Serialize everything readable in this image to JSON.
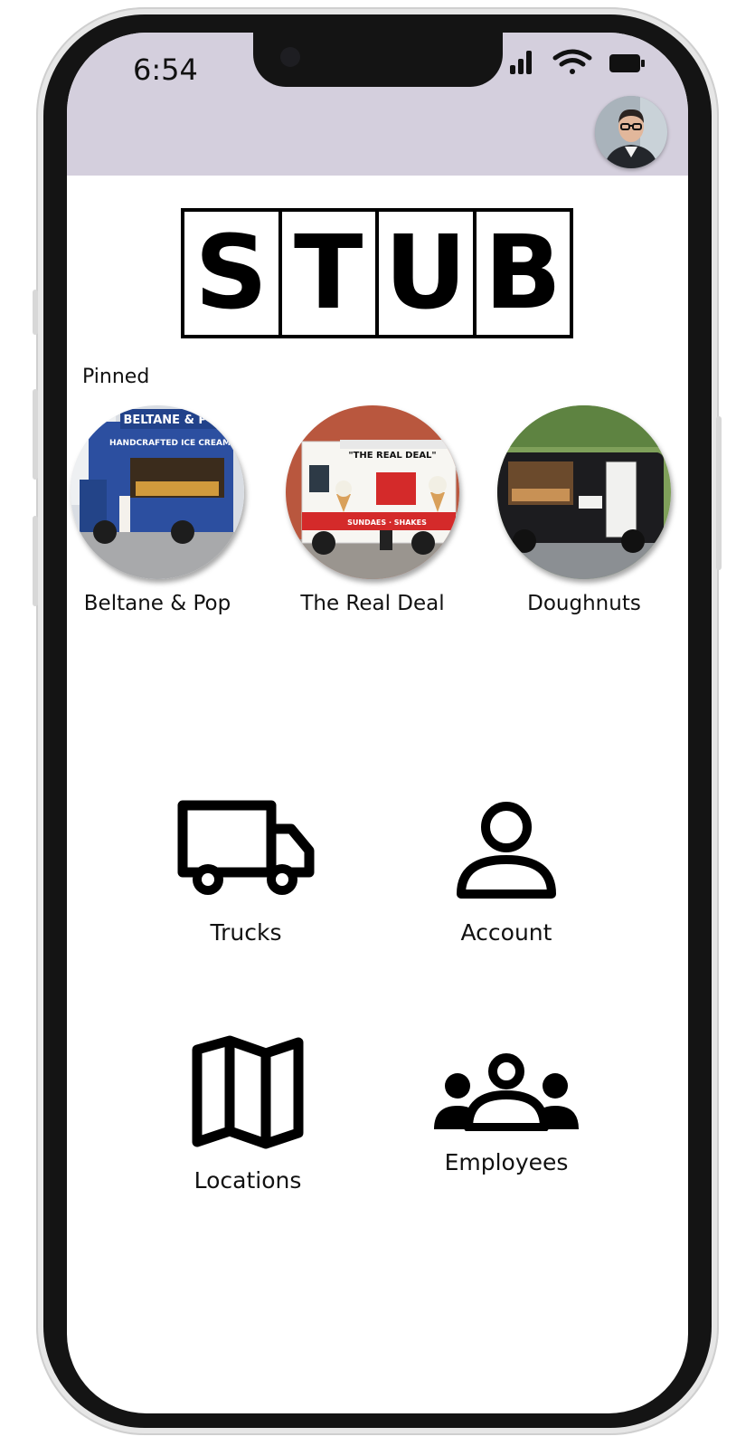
{
  "status_bar": {
    "time": "6:54"
  },
  "brand": {
    "letters": [
      "S",
      "T",
      "U",
      "B"
    ]
  },
  "pinned": {
    "label": "Pinned",
    "items": [
      {
        "name": "Beltane & Pop",
        "sign": "BELTANE & POP",
        "tagline": "HANDCRAFTED ICE CREAM",
        "color": "#2c4fa0"
      },
      {
        "name": "The Real Deal",
        "sign": "\"THE REAL DEAL\"",
        "tagline": "SUNDAES · SHAKES",
        "color": "#d42a2a"
      },
      {
        "name": "Doughnuts",
        "sign": "",
        "tagline": "",
        "color": "#1c1c1f"
      }
    ]
  },
  "nav": {
    "trucks": "Trucks",
    "account": "Account",
    "locations": "Locations",
    "employees": "Employees"
  }
}
